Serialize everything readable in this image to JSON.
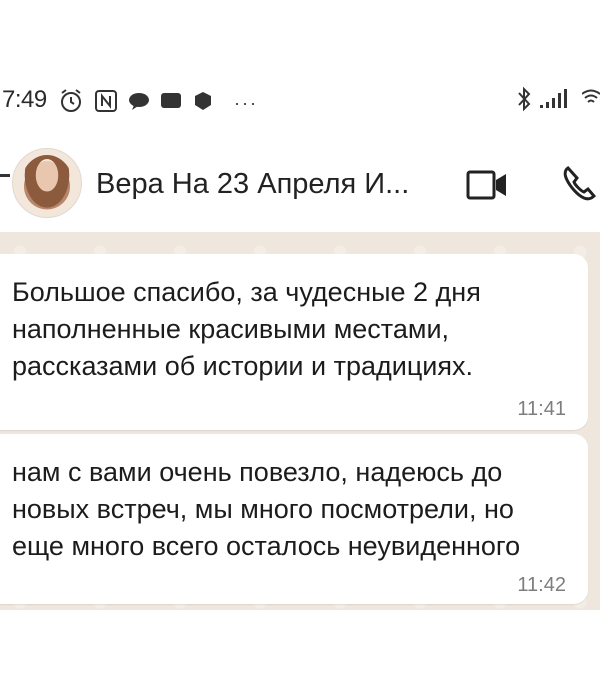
{
  "status_bar": {
    "time": "7:49",
    "left_icons": [
      "alarm-icon",
      "nfc-icon",
      "chat-bubble-icon",
      "message-icon",
      "app-icon"
    ],
    "overflow": "···",
    "right_icons": [
      "bluetooth-icon",
      "signal-icon",
      "wifi-icon"
    ]
  },
  "header": {
    "contact_name": "Вера На 23 Апреля И...",
    "actions": [
      "video-call-icon",
      "phone-call-icon"
    ]
  },
  "messages": [
    {
      "text": "Большое спасибо, за чудесные 2 дня наполненные красивыми местами, рассказами об истории и традициях.",
      "time": "11:41"
    },
    {
      "text": "нам с вами очень повезло, надеюсь до новых встреч, мы много посмотрели, но еще много всего осталось неувиденного",
      "time": "11:42"
    }
  ],
  "colors": {
    "chat_background": "#efe7dd",
    "bubble": "#ffffff",
    "timestamp": "#7d7d7d"
  }
}
